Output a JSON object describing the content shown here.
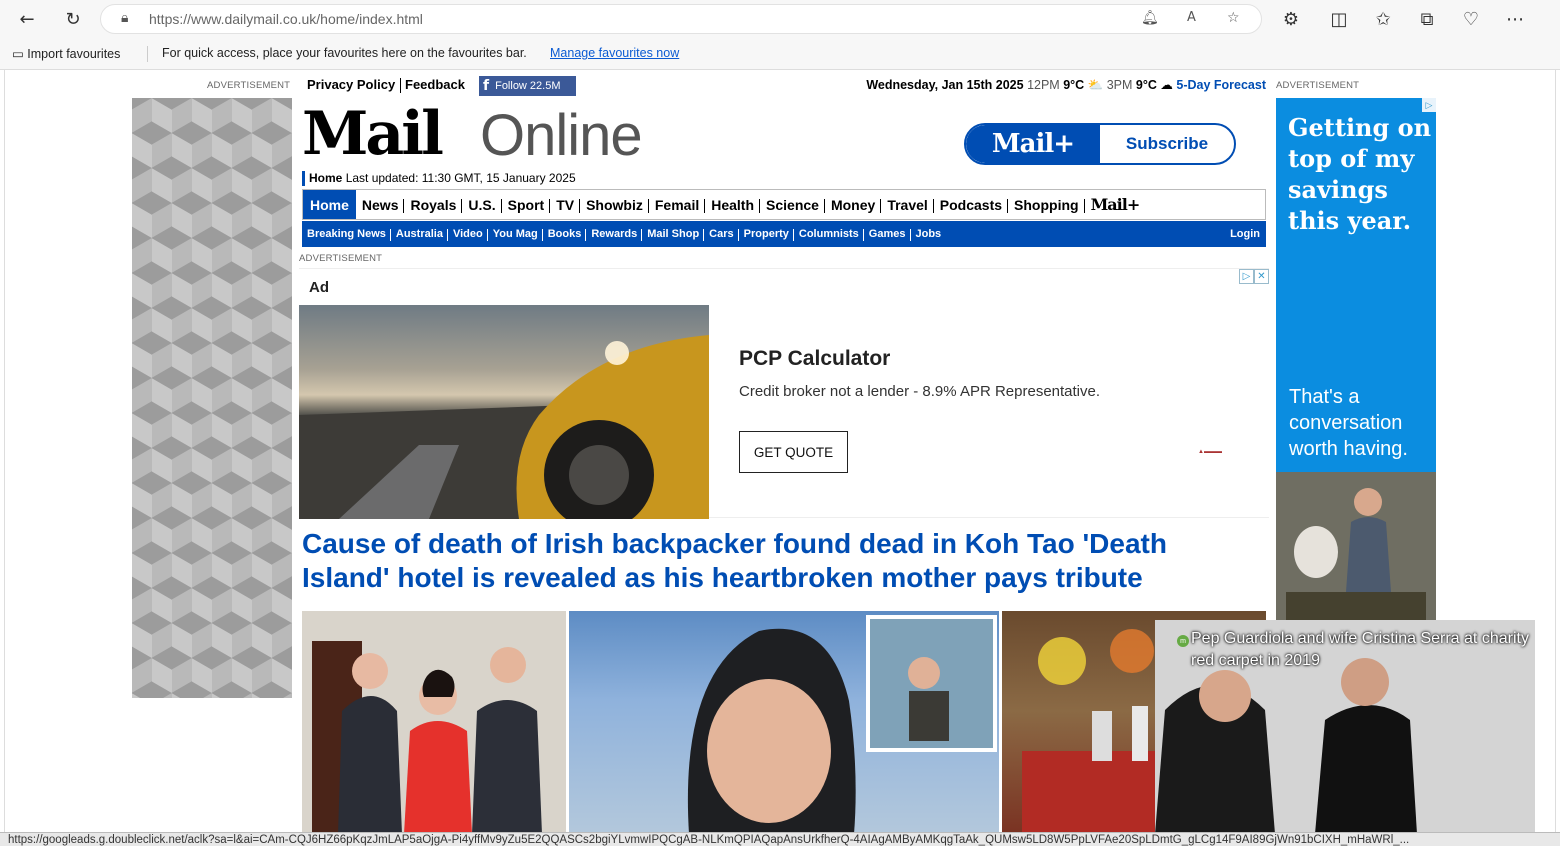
{
  "browser": {
    "url_prefix": "https://www.dailymail.co.uk",
    "url_path": "/home/index.html",
    "favbar_import": "Import favourites",
    "favbar_hint": "For quick access, place your favourites here on the favourites bar.",
    "favbar_manage": "Manage favourites now",
    "status_url": "https://googleads.g.doubleclick.net/aclk?sa=l&ai=CAm-CQJ6HZ66pKqzJmLAP5aOjgA-Pi4yffMv9yZu5E2QQASCs2bgiYLvmwIPQCgAB-NLKmQPIAQapAnsUrkfherQ-4AIAgAMByAMKqgTaAk_QUMsw5LD8W5PpLVFAe20SpLDmtG_gLCg14F9AI89GjWn91bCIXH_mHaWRl_..."
  },
  "top": {
    "advertisement_left": "ADVERTISEMENT",
    "advertisement_right": "ADVERTISEMENT",
    "privacy": "Privacy Policy",
    "feedback": "Feedback",
    "follow": "Follow 22.5M",
    "date": "Wednesday, Jan 15th 2025",
    "t1": "12PM",
    "temp1": "9°C",
    "t2": "3PM",
    "temp2": "9°C",
    "forecast": "5-Day Forecast"
  },
  "masthead": {
    "logo_mail": "Mail",
    "logo_online": "Online",
    "home": "Home",
    "last_updated": "Last updated: 11:30 GMT, 15 January 2025",
    "mailplus": "Mail+",
    "subscribe": "Subscribe"
  },
  "nav_primary": [
    "Home",
    "News",
    "Royals",
    "U.S.",
    "Sport",
    "TV",
    "Showbiz",
    "Femail",
    "Health",
    "Science",
    "Money",
    "Travel",
    "Podcasts",
    "Shopping",
    "Mail+"
  ],
  "nav_secondary": [
    "Breaking News",
    "Australia",
    "Video",
    "You Mag",
    "Books",
    "Rewards",
    "Mail Shop",
    "Cars",
    "Property",
    "Columnists",
    "Games",
    "Jobs"
  ],
  "nav_login": "Login",
  "ad": {
    "label": "ADVERTISEMENT",
    "tag": "Ad",
    "title": "PCP Calculator",
    "subtitle": "Credit broker not a lender - 8.9% APR Representative.",
    "button": "GET QUOTE"
  },
  "headline": "Cause of death of Irish backpacker found dead in Koh Tao 'Death Island' hotel is revealed as his heartbroken mother pays tribute",
  "right_ad": {
    "headline": "Getting on top of my savings this year.",
    "sub": "That's a conversation worth having."
  },
  "video": {
    "caption": "Pep Guardiola and wife Cristina Serra at charity red carpet in 2019"
  },
  "colors": {
    "brand_blue": "#004db3",
    "facebook": "#3b5998"
  }
}
